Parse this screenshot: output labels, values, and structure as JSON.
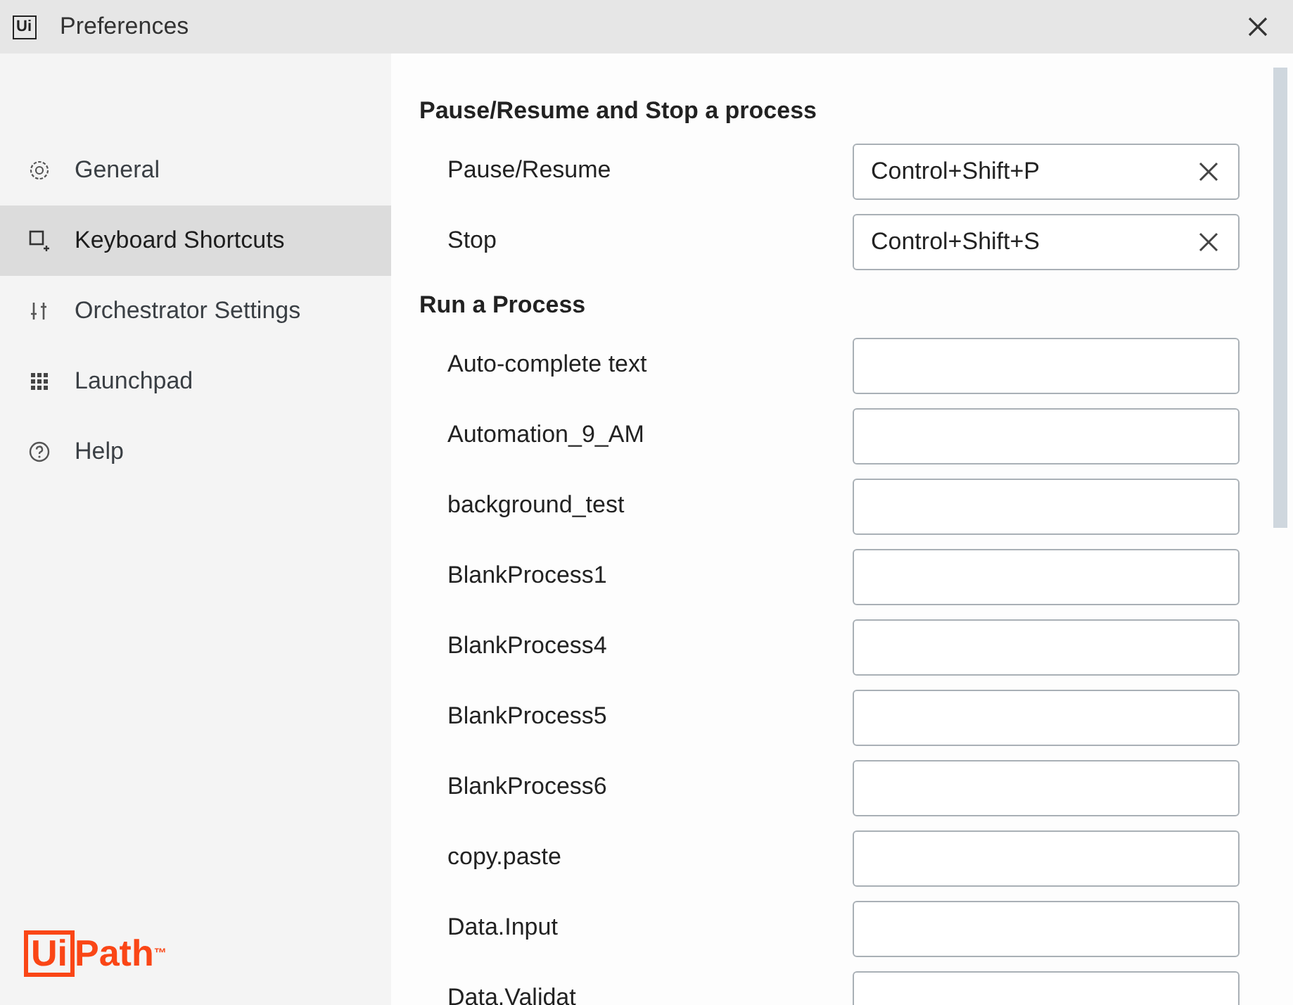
{
  "window": {
    "title": "Preferences",
    "icon_text": "Ui"
  },
  "sidebar": {
    "items": [
      {
        "label": "General",
        "selected": false
      },
      {
        "label": "Keyboard Shortcuts",
        "selected": true
      },
      {
        "label": "Orchestrator Settings",
        "selected": false
      },
      {
        "label": "Launchpad",
        "selected": false
      },
      {
        "label": "Help",
        "selected": false
      }
    ],
    "logo": {
      "text": "Path",
      "trademark": "™",
      "mark": "Ui"
    }
  },
  "sections": [
    {
      "title": "Pause/Resume and Stop a process",
      "rows": [
        {
          "label": "Pause/Resume",
          "value": "Control+Shift+P"
        },
        {
          "label": "Stop",
          "value": "Control+Shift+S"
        }
      ]
    },
    {
      "title": "Run a Process",
      "rows": [
        {
          "label": "Auto-complete text",
          "value": ""
        },
        {
          "label": "Automation_9_AM",
          "value": ""
        },
        {
          "label": "background_test",
          "value": ""
        },
        {
          "label": "BlankProcess1",
          "value": ""
        },
        {
          "label": "BlankProcess4",
          "value": ""
        },
        {
          "label": "BlankProcess5",
          "value": ""
        },
        {
          "label": "BlankProcess6",
          "value": ""
        },
        {
          "label": "copy.paste",
          "value": ""
        },
        {
          "label": "Data.Input",
          "value": ""
        },
        {
          "label": "Data.Validat",
          "value": ""
        }
      ]
    }
  ]
}
